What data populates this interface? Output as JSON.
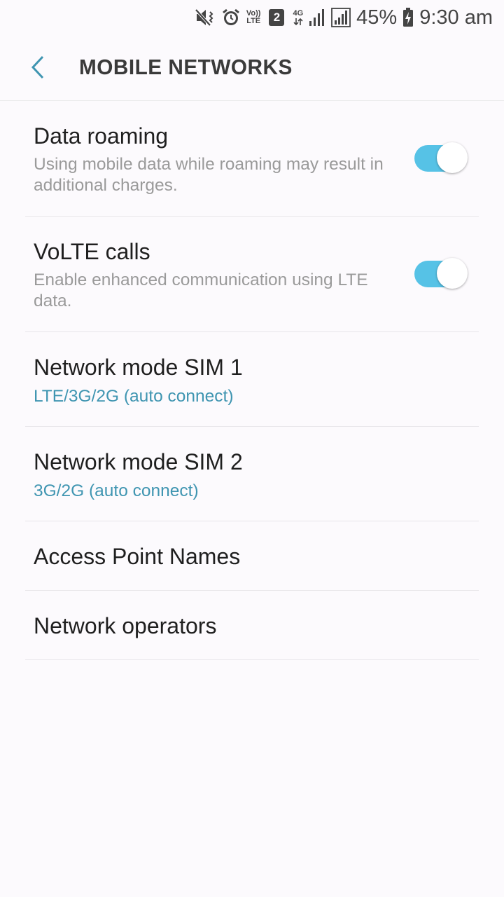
{
  "status_bar": {
    "volte_top": "Vo))",
    "volte_bottom": "LTE",
    "sim_badge": "2",
    "network_type": "4G",
    "battery_percent": "45%",
    "time": "9:30 am"
  },
  "app_bar": {
    "title": "MOBILE NETWORKS"
  },
  "settings": {
    "data_roaming": {
      "title": "Data roaming",
      "subtitle": "Using mobile data while roaming may result in additional charges.",
      "enabled": true
    },
    "volte_calls": {
      "title": "VoLTE calls",
      "subtitle": "Enable enhanced communication using LTE data.",
      "enabled": true
    },
    "network_mode_sim1": {
      "title": "Network mode SIM 1",
      "value": "LTE/3G/2G (auto connect)"
    },
    "network_mode_sim2": {
      "title": "Network mode SIM 2",
      "value": "3G/2G (auto connect)"
    },
    "access_point_names": {
      "title": "Access Point Names"
    },
    "network_operators": {
      "title": "Network operators"
    }
  },
  "colors": {
    "accent": "#56c2e6",
    "value_text": "#3f95b1",
    "back_arrow": "#3f95b1"
  },
  "icons": [
    "mute-icon",
    "alarm-icon",
    "sim-2-badge-icon",
    "data-arrows-icon",
    "signal-icon",
    "signal-icon",
    "battery-charging-icon",
    "back-arrow-icon"
  ]
}
